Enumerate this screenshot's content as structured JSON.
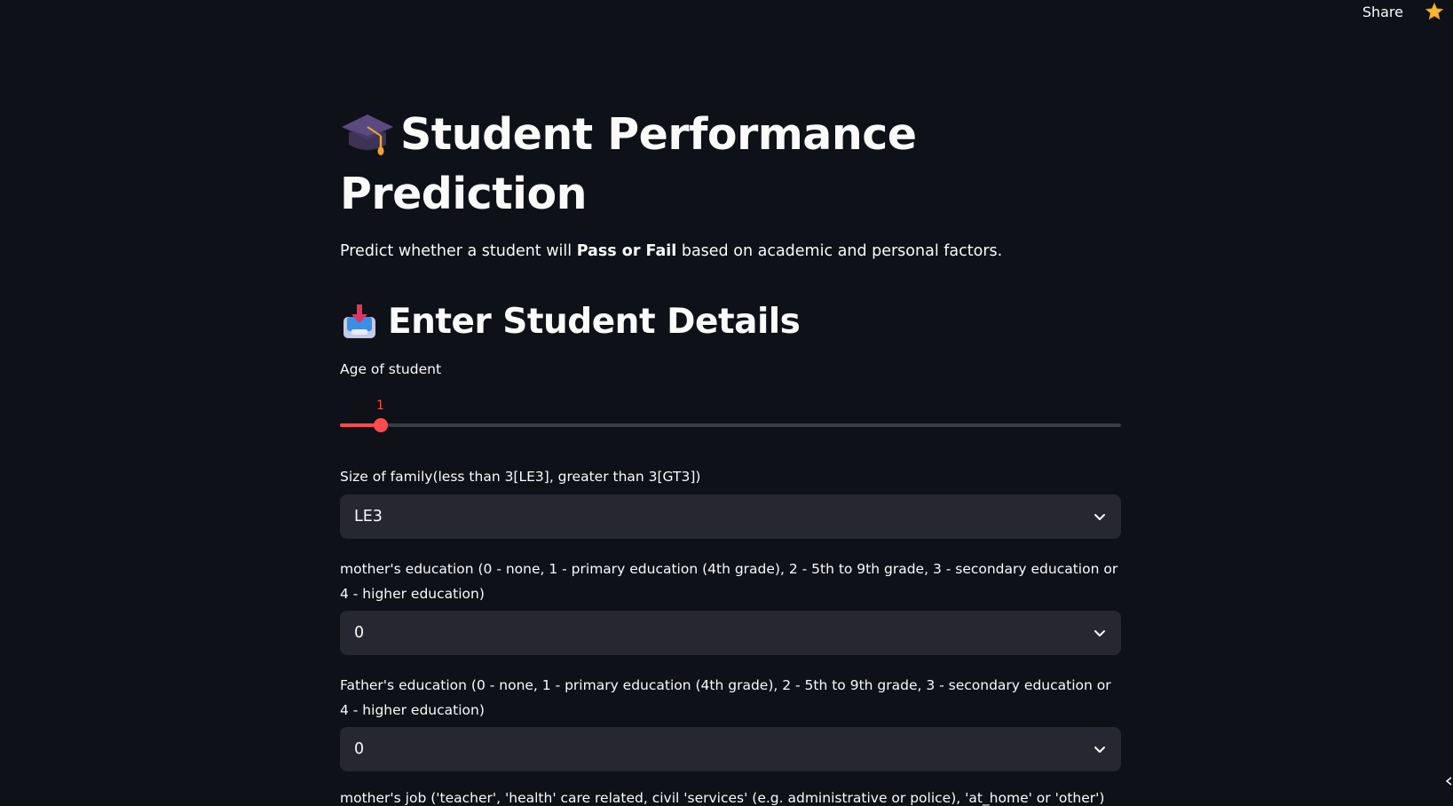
{
  "topbar": {
    "share_label": "Share",
    "star_icon": "star-icon"
  },
  "header": {
    "title_icon": "graduation-cap-icon",
    "title": "Student Performance Prediction",
    "subtitle_pre": "Predict whether a student will ",
    "subtitle_bold": "Pass or Fail",
    "subtitle_post": " based on academic and personal factors."
  },
  "section": {
    "icon": "inbox-tray-icon",
    "title": "Enter Student Details"
  },
  "fields": {
    "age": {
      "label": "Age of student",
      "value": "1",
      "fraction": 0.052
    },
    "famsize": {
      "label": "Size of family(less than 3[LE3], greater than 3[GT3])",
      "selected": "LE3"
    },
    "medu": {
      "label": "mother's education (0 - none, 1 - primary education (4th grade), 2 - 5th to 9th grade, 3 - secondary education or 4 - higher education)",
      "selected": "0"
    },
    "fedu": {
      "label": "Father's education (0 - none, 1 - primary education (4th grade), 2 - 5th to 9th grade, 3 - secondary education or 4 - higher education)",
      "selected": "0"
    },
    "mjob": {
      "label": "mother's job ('teacher', 'health' care related, civil 'services' (e.g. administrative or police), 'at_home' or 'other')"
    }
  },
  "colors": {
    "background": "#0e1117",
    "accent": "#ff4b4b",
    "select_bg": "#262730",
    "text": "#fafafa"
  }
}
